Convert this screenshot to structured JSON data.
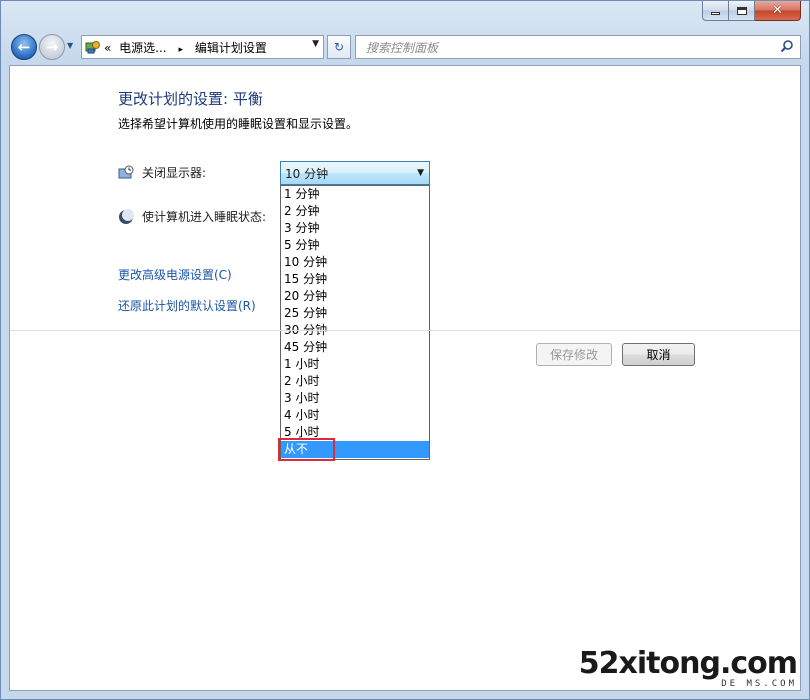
{
  "window": {
    "caption": {
      "minimize": "−",
      "maximize": "□",
      "close": "x"
    }
  },
  "nav": {
    "back_icon": "arrow-left-icon",
    "forward_icon": "arrow-right-icon",
    "address": {
      "prefix": "«",
      "crumb1": "电源选...",
      "separator": "▸",
      "crumb2": "编辑计划设置"
    },
    "search_placeholder": "搜索控制面板"
  },
  "page": {
    "title": "更改计划的设置: 平衡",
    "description": "选择希望计算机使用的睡眠设置和显示设置。",
    "display_label": "关闭显示器:",
    "sleep_label": "使计算机进入睡眠状态:",
    "display_value": "10 分钟",
    "dropdown_options": [
      "1 分钟",
      "2 分钟",
      "3 分钟",
      "5 分钟",
      "10 分钟",
      "15 分钟",
      "20 分钟",
      "25 分钟",
      "30 分钟",
      "45 分钟",
      "1 小时",
      "2 小时",
      "3 小时",
      "4 小时",
      "5 小时",
      "从不"
    ],
    "selected_option": "从不",
    "advanced_link": "更改高级电源设置(C)",
    "restore_link": "还原此计划的默认设置(R)",
    "save_button": "保存修改",
    "cancel_button": "取消"
  },
  "watermark": {
    "main": "52xitong.com",
    "sub": "DE  MS.COM"
  },
  "colors": {
    "title_blue": "#1e3a7c",
    "link_blue": "#1a56a8",
    "selection": "#3399ff",
    "highlight_red": "#d92b3a"
  }
}
